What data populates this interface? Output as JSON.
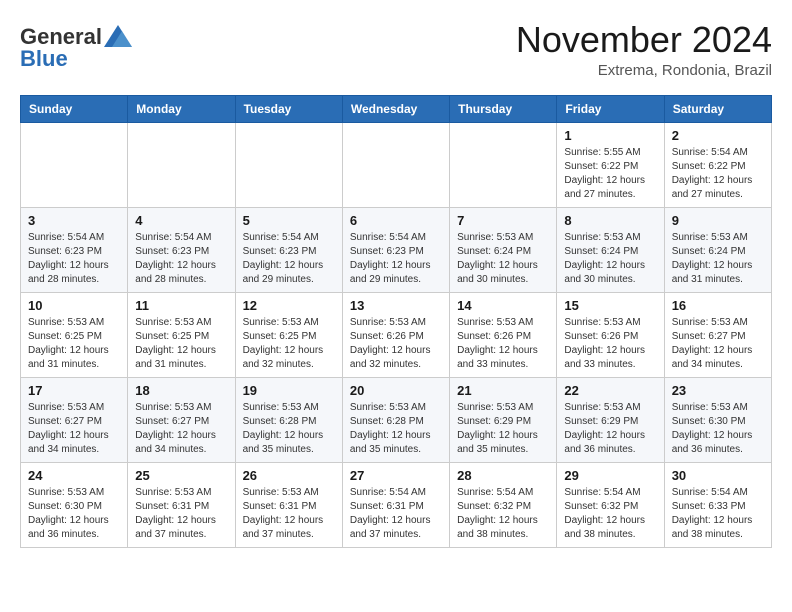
{
  "header": {
    "logo_general": "General",
    "logo_blue": "Blue",
    "month_title": "November 2024",
    "subtitle": "Extrema, Rondonia, Brazil"
  },
  "calendar": {
    "days_of_week": [
      "Sunday",
      "Monday",
      "Tuesday",
      "Wednesday",
      "Thursday",
      "Friday",
      "Saturday"
    ],
    "weeks": [
      [
        {
          "day": "",
          "info": ""
        },
        {
          "day": "",
          "info": ""
        },
        {
          "day": "",
          "info": ""
        },
        {
          "day": "",
          "info": ""
        },
        {
          "day": "",
          "info": ""
        },
        {
          "day": "1",
          "info": "Sunrise: 5:55 AM\nSunset: 6:22 PM\nDaylight: 12 hours and 27 minutes."
        },
        {
          "day": "2",
          "info": "Sunrise: 5:54 AM\nSunset: 6:22 PM\nDaylight: 12 hours and 27 minutes."
        }
      ],
      [
        {
          "day": "3",
          "info": "Sunrise: 5:54 AM\nSunset: 6:23 PM\nDaylight: 12 hours and 28 minutes."
        },
        {
          "day": "4",
          "info": "Sunrise: 5:54 AM\nSunset: 6:23 PM\nDaylight: 12 hours and 28 minutes."
        },
        {
          "day": "5",
          "info": "Sunrise: 5:54 AM\nSunset: 6:23 PM\nDaylight: 12 hours and 29 minutes."
        },
        {
          "day": "6",
          "info": "Sunrise: 5:54 AM\nSunset: 6:23 PM\nDaylight: 12 hours and 29 minutes."
        },
        {
          "day": "7",
          "info": "Sunrise: 5:53 AM\nSunset: 6:24 PM\nDaylight: 12 hours and 30 minutes."
        },
        {
          "day": "8",
          "info": "Sunrise: 5:53 AM\nSunset: 6:24 PM\nDaylight: 12 hours and 30 minutes."
        },
        {
          "day": "9",
          "info": "Sunrise: 5:53 AM\nSunset: 6:24 PM\nDaylight: 12 hours and 31 minutes."
        }
      ],
      [
        {
          "day": "10",
          "info": "Sunrise: 5:53 AM\nSunset: 6:25 PM\nDaylight: 12 hours and 31 minutes."
        },
        {
          "day": "11",
          "info": "Sunrise: 5:53 AM\nSunset: 6:25 PM\nDaylight: 12 hours and 31 minutes."
        },
        {
          "day": "12",
          "info": "Sunrise: 5:53 AM\nSunset: 6:25 PM\nDaylight: 12 hours and 32 minutes."
        },
        {
          "day": "13",
          "info": "Sunrise: 5:53 AM\nSunset: 6:26 PM\nDaylight: 12 hours and 32 minutes."
        },
        {
          "day": "14",
          "info": "Sunrise: 5:53 AM\nSunset: 6:26 PM\nDaylight: 12 hours and 33 minutes."
        },
        {
          "day": "15",
          "info": "Sunrise: 5:53 AM\nSunset: 6:26 PM\nDaylight: 12 hours and 33 minutes."
        },
        {
          "day": "16",
          "info": "Sunrise: 5:53 AM\nSunset: 6:27 PM\nDaylight: 12 hours and 34 minutes."
        }
      ],
      [
        {
          "day": "17",
          "info": "Sunrise: 5:53 AM\nSunset: 6:27 PM\nDaylight: 12 hours and 34 minutes."
        },
        {
          "day": "18",
          "info": "Sunrise: 5:53 AM\nSunset: 6:27 PM\nDaylight: 12 hours and 34 minutes."
        },
        {
          "day": "19",
          "info": "Sunrise: 5:53 AM\nSunset: 6:28 PM\nDaylight: 12 hours and 35 minutes."
        },
        {
          "day": "20",
          "info": "Sunrise: 5:53 AM\nSunset: 6:28 PM\nDaylight: 12 hours and 35 minutes."
        },
        {
          "day": "21",
          "info": "Sunrise: 5:53 AM\nSunset: 6:29 PM\nDaylight: 12 hours and 35 minutes."
        },
        {
          "day": "22",
          "info": "Sunrise: 5:53 AM\nSunset: 6:29 PM\nDaylight: 12 hours and 36 minutes."
        },
        {
          "day": "23",
          "info": "Sunrise: 5:53 AM\nSunset: 6:30 PM\nDaylight: 12 hours and 36 minutes."
        }
      ],
      [
        {
          "day": "24",
          "info": "Sunrise: 5:53 AM\nSunset: 6:30 PM\nDaylight: 12 hours and 36 minutes."
        },
        {
          "day": "25",
          "info": "Sunrise: 5:53 AM\nSunset: 6:31 PM\nDaylight: 12 hours and 37 minutes."
        },
        {
          "day": "26",
          "info": "Sunrise: 5:53 AM\nSunset: 6:31 PM\nDaylight: 12 hours and 37 minutes."
        },
        {
          "day": "27",
          "info": "Sunrise: 5:54 AM\nSunset: 6:31 PM\nDaylight: 12 hours and 37 minutes."
        },
        {
          "day": "28",
          "info": "Sunrise: 5:54 AM\nSunset: 6:32 PM\nDaylight: 12 hours and 38 minutes."
        },
        {
          "day": "29",
          "info": "Sunrise: 5:54 AM\nSunset: 6:32 PM\nDaylight: 12 hours and 38 minutes."
        },
        {
          "day": "30",
          "info": "Sunrise: 5:54 AM\nSunset: 6:33 PM\nDaylight: 12 hours and 38 minutes."
        }
      ]
    ]
  }
}
